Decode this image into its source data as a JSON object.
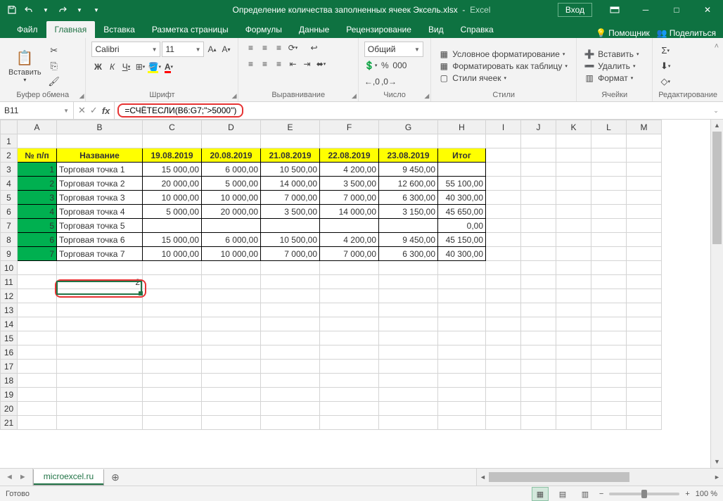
{
  "titlebar": {
    "filename": "Определение количества заполненных ячеек Эксель.xlsx",
    "app": "Excel",
    "login": "Вход"
  },
  "tabs": {
    "items": [
      "Файл",
      "Главная",
      "Вставка",
      "Разметка страницы",
      "Формулы",
      "Данные",
      "Рецензирование",
      "Вид",
      "Справка"
    ],
    "active_index": 1,
    "help_placeholder": "Помощник",
    "share": "Поделиться"
  },
  "ribbon": {
    "paste": "Вставить",
    "groups": {
      "clipboard": "Буфер обмена",
      "font": "Шрифт",
      "align": "Выравнивание",
      "number": "Число",
      "styles": "Стили",
      "cells": "Ячейки",
      "editing": "Редактирование"
    },
    "font_name": "Calibri",
    "font_size": "11",
    "number_format": "Общий",
    "cond_fmt": "Условное форматирование",
    "fmt_table": "Форматировать как таблицу",
    "cell_styles": "Стили ячеек",
    "insert": "Вставить",
    "delete": "Удалить",
    "format": "Формат"
  },
  "formula_bar": {
    "name": "B11",
    "formula": "=СЧЁТЕСЛИ(B6:G7;\">5000\")"
  },
  "grid": {
    "columns": [
      "A",
      "B",
      "C",
      "D",
      "E",
      "F",
      "G",
      "H",
      "I",
      "J",
      "K",
      "L",
      "M"
    ],
    "header": [
      "№ п/п",
      "Название",
      "19.08.2019",
      "20.08.2019",
      "21.08.2019",
      "22.08.2019",
      "23.08.2019",
      "Итог"
    ],
    "rows": [
      {
        "n": "1",
        "name": "Торговая точка 1",
        "v": [
          "15 000,00",
          "6 000,00",
          "10 500,00",
          "4 200,00",
          "9 450,00"
        ],
        "sum": ""
      },
      {
        "n": "2",
        "name": "Торговая точка 2",
        "v": [
          "20 000,00",
          "5 000,00",
          "14 000,00",
          "3 500,00",
          "12 600,00"
        ],
        "sum": "55 100,00"
      },
      {
        "n": "3",
        "name": "Торговая точка 3",
        "v": [
          "10 000,00",
          "10 000,00",
          "7 000,00",
          "7 000,00",
          "6 300,00"
        ],
        "sum": "40 300,00"
      },
      {
        "n": "4",
        "name": "Торговая точка 4",
        "v": [
          "5 000,00",
          "20 000,00",
          "3 500,00",
          "14 000,00",
          "3 150,00"
        ],
        "sum": "45 650,00"
      },
      {
        "n": "5",
        "name": "Торговая точка 5",
        "v": [
          "",
          "",
          "",
          "",
          ""
        ],
        "sum": "0,00"
      },
      {
        "n": "6",
        "name": "Торговая точка 6",
        "v": [
          "15 000,00",
          "6 000,00",
          "10 500,00",
          "4 200,00",
          "9 450,00"
        ],
        "sum": "45 150,00"
      },
      {
        "n": "7",
        "name": "Торговая точка 7",
        "v": [
          "10 000,00",
          "10 000,00",
          "7 000,00",
          "7 000,00",
          "6 300,00"
        ],
        "sum": "40 300,00"
      }
    ],
    "result_cell": "2"
  },
  "sheetbar": {
    "tab": "microexcel.ru"
  },
  "status": {
    "ready": "Готово",
    "zoom": "100 %"
  }
}
